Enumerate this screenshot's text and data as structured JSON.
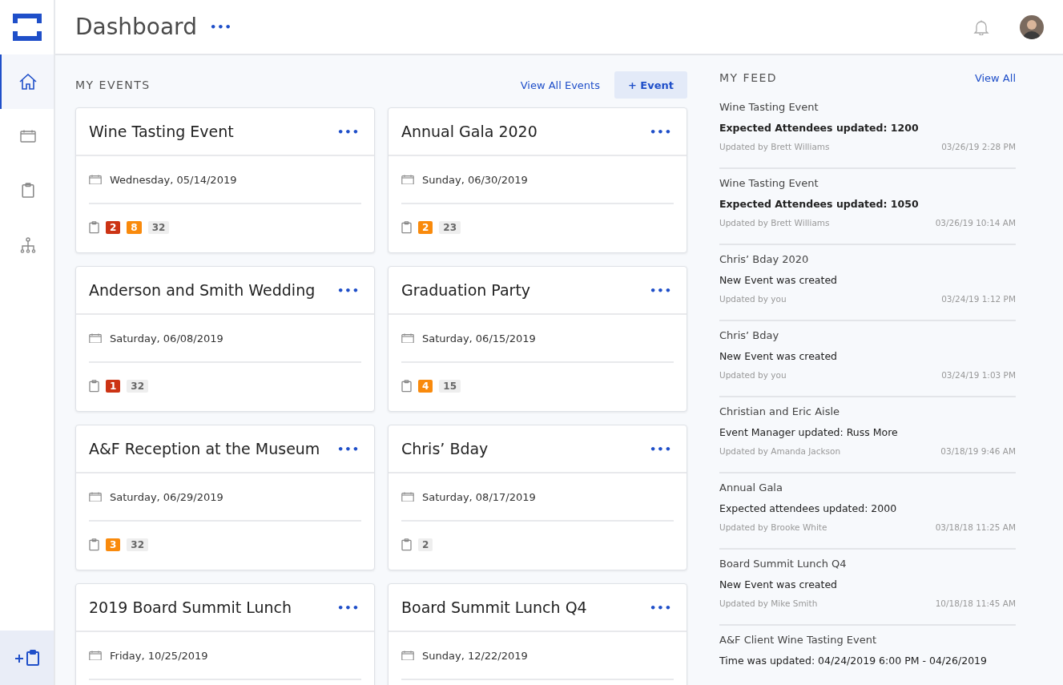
{
  "header": {
    "title": "Dashboard",
    "menu": "•••"
  },
  "sidebar": {
    "items": [
      {
        "kind": "home",
        "selected": true
      },
      {
        "kind": "calendar",
        "selected": false
      },
      {
        "kind": "clipboard",
        "selected": false
      },
      {
        "kind": "org",
        "selected": false
      }
    ]
  },
  "events": {
    "heading": "MY EVENTS",
    "view_all": "View All Events",
    "add_button": "+ Event",
    "cards": [
      {
        "title": "Wine Tasting Event",
        "menu": "•••",
        "date": "Wednesday, 05/14/2019",
        "counts": [
          {
            "kind": "critical",
            "value": "2"
          },
          {
            "kind": "warning",
            "value": "8"
          },
          {
            "kind": "total",
            "value": "32"
          }
        ]
      },
      {
        "title": "Annual Gala 2020",
        "menu": "•••",
        "date": "Sunday, 06/30/2019",
        "counts": [
          {
            "kind": "warning",
            "value": "2"
          },
          {
            "kind": "total",
            "value": "23"
          }
        ]
      },
      {
        "title": "Anderson and Smith Wedding",
        "menu": "•••",
        "date": "Saturday, 06/08/2019",
        "counts": [
          {
            "kind": "critical",
            "value": "1"
          },
          {
            "kind": "total",
            "value": "32"
          }
        ]
      },
      {
        "title": "Graduation Party",
        "menu": "•••",
        "date": "Saturday, 06/15/2019",
        "counts": [
          {
            "kind": "warning",
            "value": "4"
          },
          {
            "kind": "total",
            "value": "15"
          }
        ]
      },
      {
        "title": "A&F Reception at the Museum",
        "menu": "•••",
        "date": "Saturday, 06/29/2019",
        "counts": [
          {
            "kind": "warning",
            "value": "3"
          },
          {
            "kind": "total",
            "value": "32"
          }
        ]
      },
      {
        "title": "Chris’ Bday",
        "menu": "•••",
        "date": "Saturday, 08/17/2019",
        "counts": [
          {
            "kind": "total",
            "value": "2"
          }
        ]
      },
      {
        "title": "2019 Board Summit Lunch",
        "menu": "•••",
        "date": "Friday, 10/25/2019"
      },
      {
        "title": "Board Summit Lunch Q4",
        "menu": "•••",
        "date": "Sunday, 12/22/2019"
      }
    ]
  },
  "feed": {
    "heading": "MY FEED",
    "view_all": "View All",
    "items": [
      {
        "event": "Wine Tasting Event",
        "change": "Expected Attendees updated: 1200",
        "highlighted": true,
        "by": "Updated by Brett Williams",
        "time": "03/26/19 2:28 PM"
      },
      {
        "event": "Wine Tasting Event",
        "change": "Expected Attendees updated: 1050",
        "highlighted": true,
        "by": "Updated by Brett Williams",
        "time": "03/26/19 10:14 AM"
      },
      {
        "event": "Chris’ Bday 2020",
        "change": "New Event was created",
        "highlighted": false,
        "by": "Updated by you",
        "time": "03/24/19 1:12 PM"
      },
      {
        "event": "Chris’ Bday",
        "change": "New Event was created",
        "highlighted": false,
        "by": "Updated by you",
        "time": "03/24/19 1:03 PM"
      },
      {
        "event": "Christian and Eric Aisle",
        "change": "Event Manager updated: Russ More",
        "highlighted": false,
        "by": "Updated by Amanda Jackson",
        "time": "03/18/19 9:46 AM"
      },
      {
        "event": "Annual Gala",
        "change": "Expected attendees updated: 2000",
        "highlighted": false,
        "by": "Updated by Brooke White",
        "time": "03/18/18 11:25 AM"
      },
      {
        "event": "Board Summit Lunch Q4",
        "change": "New Event was created",
        "highlighted": false,
        "by": "Updated by Mike Smith",
        "time": "10/18/18 11:45 AM"
      },
      {
        "event": "A&F Client Wine Tasting Event",
        "change": "Time was updated: 04/24/2019 6:00 PM - 04/26/2019",
        "highlighted": false
      }
    ]
  }
}
